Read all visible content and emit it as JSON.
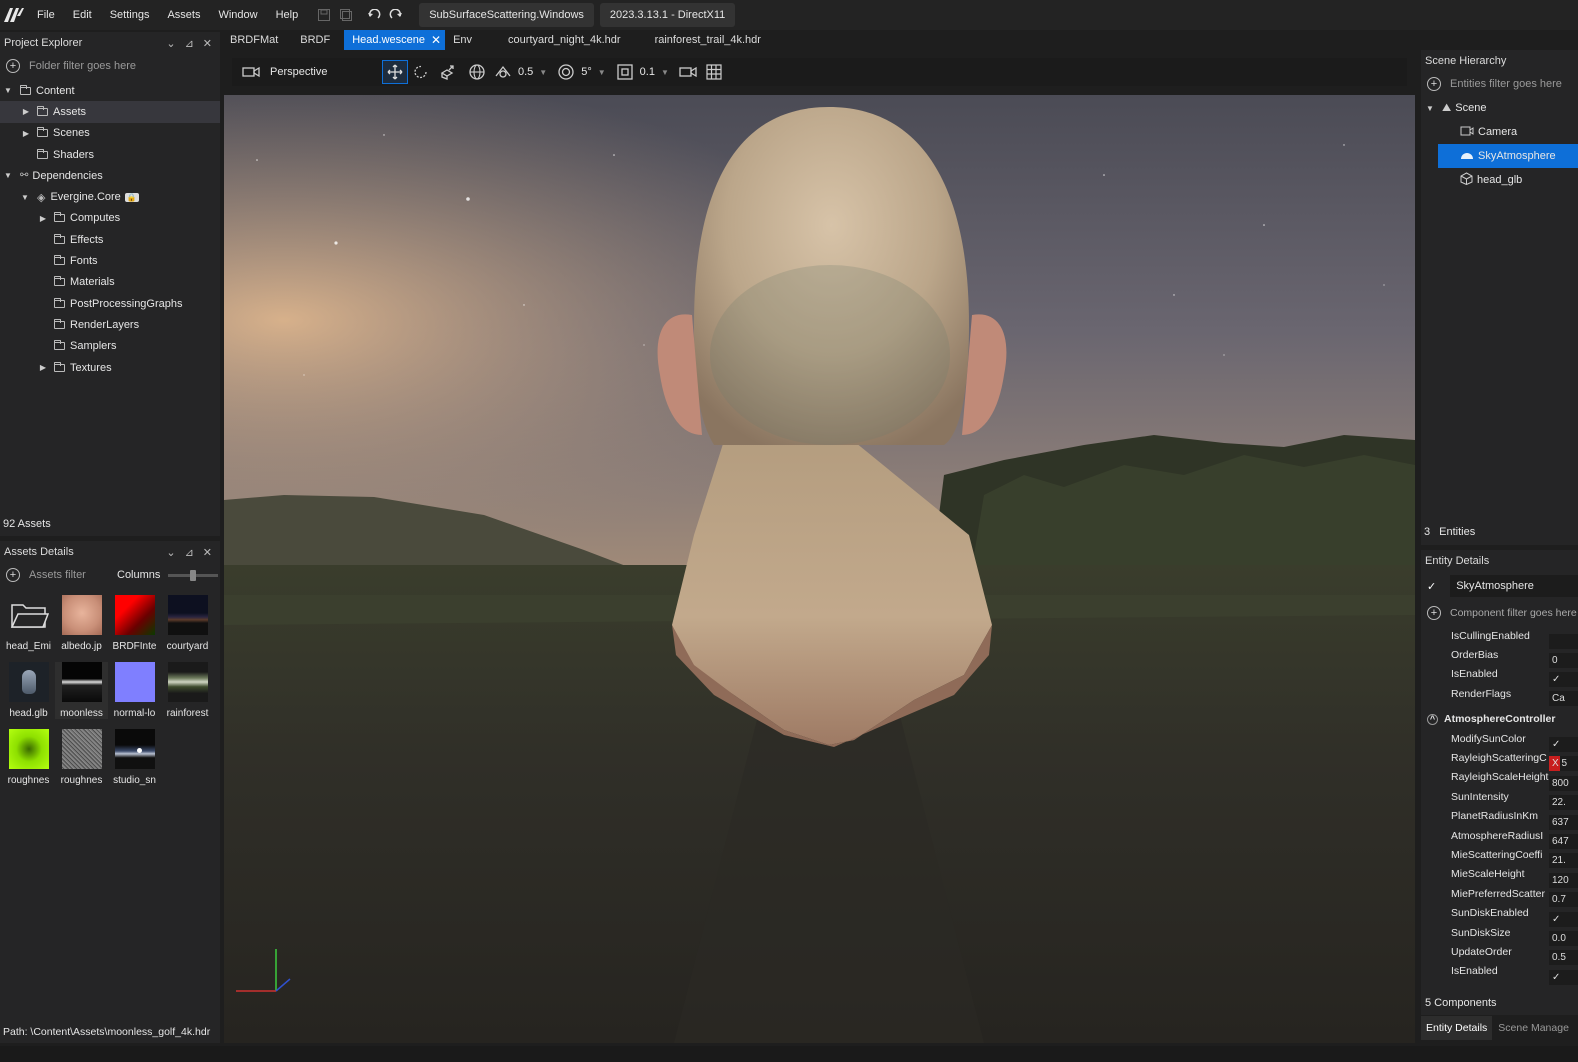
{
  "menubar": {
    "items": [
      "File",
      "Edit",
      "Settings",
      "Assets",
      "Window",
      "Help"
    ],
    "project": "SubSurfaceScattering.Windows",
    "version": "2023.3.13.1 - DirectX11"
  },
  "tabs": [
    "BRDFMat",
    "BRDF",
    "Head.wescene",
    "Env",
    "courtyard_night_4k.hdr",
    "rainforest_trail_4k.hdr"
  ],
  "project_explorer": {
    "title": "Project Explorer",
    "filter_placeholder": "Folder filter goes here",
    "tree": [
      "Content",
      "Assets",
      "Scenes",
      "Shaders",
      "Dependencies",
      "Evergine.Core",
      "Computes",
      "Effects",
      "Fonts",
      "Materials",
      "PostProcessingGraphs",
      "RenderLayers",
      "Samplers",
      "Textures"
    ],
    "count": "92 Assets"
  },
  "assets_details": {
    "title": "Assets Details",
    "filter_placeholder": "Assets filter",
    "columns_label": "Columns",
    "items": [
      "head_Emi",
      "albedo.jp",
      "BRDFInte",
      "courtyard",
      "head.glb",
      "moonless",
      "normal-lo",
      "rainforest",
      "roughnes",
      "roughnes",
      "studio_sn"
    ],
    "path": "Path: \\Content\\Assets\\moonless_golf_4k.hdr"
  },
  "viewport_toolbar": {
    "camera": "Perspective",
    "translate_snap": "0.5",
    "rotate_snap": "5°",
    "scale_snap": "0.1"
  },
  "scene_hierarchy": {
    "title": "Scene Hierarchy",
    "filter_placeholder": "Entities filter goes here",
    "tree": [
      "Scene",
      "Camera",
      "SkyAtmosphere",
      "head_glb"
    ],
    "count_num": "3",
    "count_label": "Entities"
  },
  "entity_details": {
    "title": "Entity Details",
    "entity_name": "SkyAtmosphere",
    "component_filter": "Component filter goes here",
    "props": [
      {
        "name": "IsCullingEnabled",
        "value": ""
      },
      {
        "name": "OrderBias",
        "value": "0"
      },
      {
        "name": "IsEnabled",
        "value": "✓"
      },
      {
        "name": "RenderFlags",
        "value": "Ca"
      }
    ],
    "component_title": "AtmosphereController",
    "comp_props": [
      {
        "name": "ModifySunColor",
        "value": "✓"
      },
      {
        "name": "RayleighScatteringC",
        "value": "X 5"
      },
      {
        "name": "RayleighScaleHeight",
        "value": "800"
      },
      {
        "name": "SunIntensity",
        "value": "22."
      },
      {
        "name": "PlanetRadiusInKm",
        "value": "637"
      },
      {
        "name": "AtmosphereRadiusI",
        "value": "647"
      },
      {
        "name": "MieScatteringCoeffi",
        "value": "21."
      },
      {
        "name": "MieScaleHeight",
        "value": "120"
      },
      {
        "name": "MiePreferredScatter",
        "value": "0.7"
      },
      {
        "name": "SunDiskEnabled",
        "value": "✓"
      },
      {
        "name": "SunDiskSize",
        "value": "0.0"
      },
      {
        "name": "UpdateOrder",
        "value": "0.5"
      },
      {
        "name": "IsEnabled",
        "value": "✓"
      }
    ],
    "components_count": "5 Components",
    "bottom_tabs": [
      "Entity Details",
      "Scene Manage"
    ]
  }
}
